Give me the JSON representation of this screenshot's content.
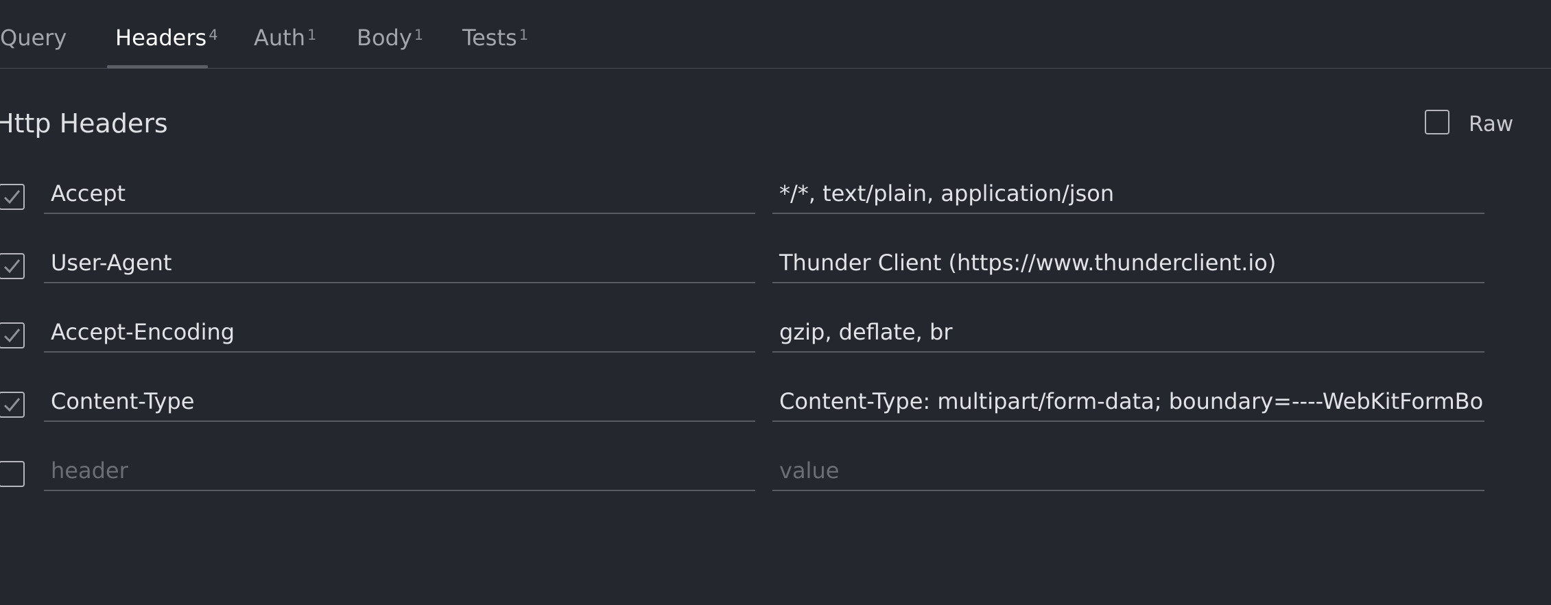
{
  "tabs": [
    {
      "label": "Query",
      "count": ""
    },
    {
      "label": "Headers",
      "count": "4"
    },
    {
      "label": "Auth",
      "count": "1"
    },
    {
      "label": "Body",
      "count": "1"
    },
    {
      "label": "Tests",
      "count": "1"
    }
  ],
  "active_tab": "Headers",
  "section": {
    "title": "Http Headers",
    "raw_label": "Raw",
    "raw_checked": false
  },
  "headers": [
    {
      "enabled": true,
      "key": "Accept",
      "value": "*/*, text/plain, application/json"
    },
    {
      "enabled": true,
      "key": "User-Agent",
      "value": "Thunder Client (https://www.thunderclient.io)"
    },
    {
      "enabled": true,
      "key": "Accept-Encoding",
      "value": "gzip, deflate, br"
    },
    {
      "enabled": true,
      "key": "Content-Type",
      "value": "Content-Type: multipart/form-data; boundary=----WebKitFormBoundary"
    }
  ],
  "new_row": {
    "enabled": false,
    "key_placeholder": "header",
    "value_placeholder": "value"
  },
  "colors": {
    "background": "#25272f",
    "active_tab_text": "#ffffff",
    "inactive_tab_text": "#a4a6ae",
    "field_underline": "#5a5c64"
  }
}
